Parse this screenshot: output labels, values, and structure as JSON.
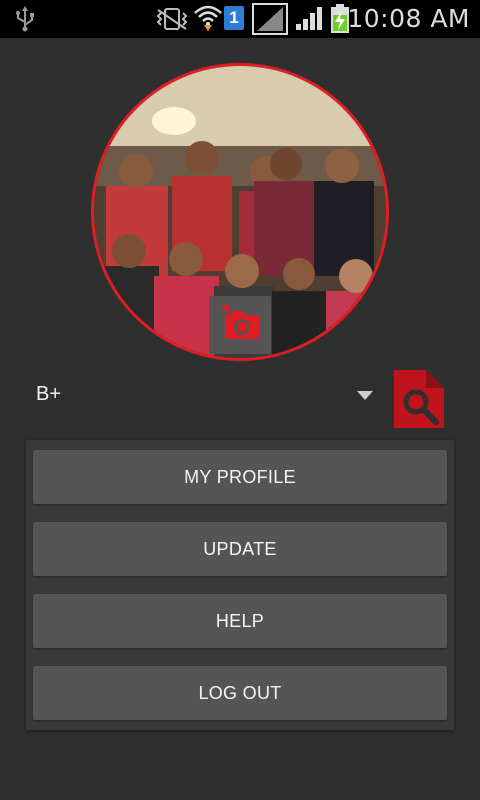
{
  "status_bar": {
    "time": "10:08 AM",
    "sim_number": "1",
    "icons": [
      "usb-icon",
      "vibrate-mute-icon",
      "wifi-icon",
      "sim-icon",
      "no-signal-icon",
      "signal-icon",
      "battery-charging-icon"
    ]
  },
  "profile": {
    "camera_icon": "add-photo-camera-icon"
  },
  "blood_group": {
    "selected": "B+",
    "search_icon": "document-search-icon"
  },
  "menu": {
    "my_profile": "MY PROFILE",
    "update": "UPDATE",
    "help": "HELP",
    "log_out": "LOG OUT"
  },
  "colors": {
    "accent": "#e31b23",
    "background": "#2f2f2f",
    "panel": "#3a3a3a",
    "button": "#555555",
    "status_bar": "#000000"
  }
}
